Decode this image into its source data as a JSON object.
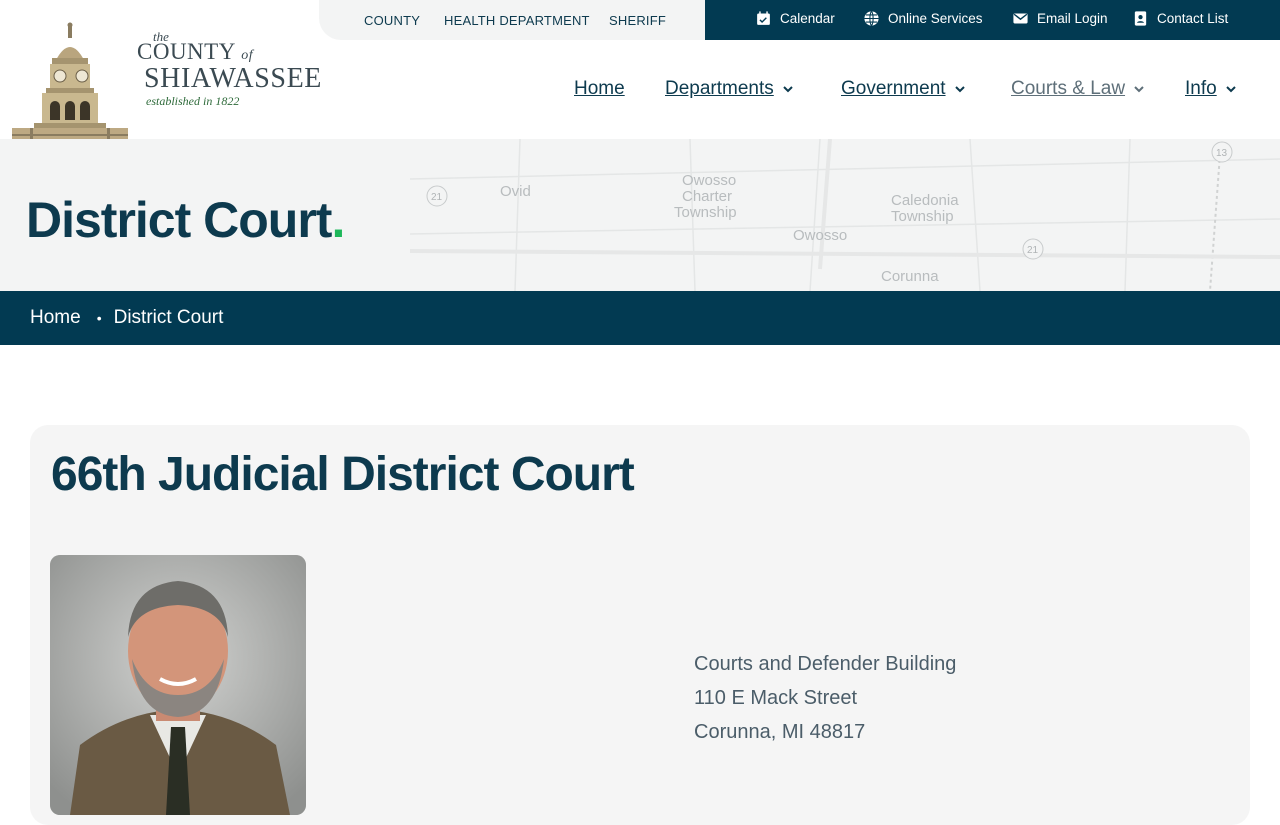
{
  "topbar": {
    "left_links": [
      "COUNTY",
      "HEALTH DEPARTMENT",
      "SHERIFF"
    ],
    "right_links": [
      {
        "label": "Calendar",
        "icon": "calendar-check-icon"
      },
      {
        "label": "Online Services",
        "icon": "globe-icon"
      },
      {
        "label": "Email Login",
        "icon": "mail-icon"
      },
      {
        "label": "Contact List",
        "icon": "contact-card-icon"
      }
    ]
  },
  "logo": {
    "the": "the",
    "county": "COUNTY",
    "of": "of",
    "name": "SHIAWASSEE",
    "established": "established in 1822"
  },
  "nav": {
    "items": [
      {
        "label": "Home",
        "dropdown": false
      },
      {
        "label": "Departments",
        "dropdown": true
      },
      {
        "label": "Government",
        "dropdown": true
      },
      {
        "label": "Courts & Law",
        "dropdown": true
      },
      {
        "label": "Info",
        "dropdown": true
      }
    ]
  },
  "hero": {
    "title": "District Court",
    "title_dot": ".",
    "map_labels": [
      "Ovid",
      "Owosso",
      "Charter",
      "Township",
      "Owosso",
      "Caledonia",
      "Township",
      "Corunna",
      "21",
      "21",
      "13"
    ]
  },
  "breadcrumb": {
    "home": "Home",
    "separator": "•",
    "current": "District Court"
  },
  "content": {
    "title": "66th Judicial District Court",
    "address": [
      "Courts and Defender Building",
      "110 E Mack Street",
      "Corunna, MI 48817"
    ]
  },
  "colors": {
    "navy": "#023a52",
    "text": "#0d3a4e",
    "accent_green": "#1db75a",
    "muted": "#5e6f79"
  }
}
